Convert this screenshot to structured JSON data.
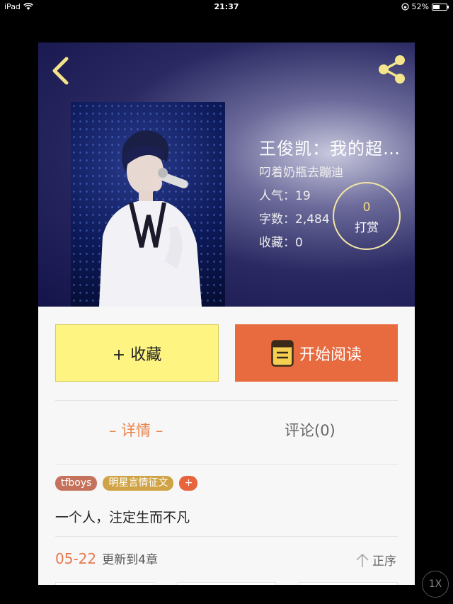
{
  "status_bar": {
    "device": "iPad",
    "time": "21:37",
    "battery": "52%",
    "battery_level": 0.52
  },
  "book": {
    "title": "王俊凯：我的超…",
    "author": "叼着奶瓶去蹦迪",
    "popularity": "人气：19",
    "word_count": "字数：2,484",
    "favorites": "收藏：0"
  },
  "reward": {
    "count": "0",
    "label": "打赏"
  },
  "actions": {
    "favorite_label": "+ 收藏",
    "read_label": "开始阅读"
  },
  "tabs": [
    {
      "label": "– 详情 –",
      "active": true
    },
    {
      "label": "评论(0)",
      "active": false
    }
  ],
  "tags": [
    "tfboys",
    "明星言情征文",
    "+"
  ],
  "summary": "一个人，注定生而不凡",
  "update": {
    "date": "05-22",
    "text": "更新到4章",
    "order_label": "正序"
  },
  "zoom_label": "1X",
  "colors": {
    "accent_orange": "#e86a3f",
    "favorite_yellow": "#fef481",
    "tab_active": "#e8864f"
  },
  "icons": [
    "back-icon",
    "share-icon",
    "book-icon",
    "arrow-up-icon",
    "wifi-icon"
  ]
}
